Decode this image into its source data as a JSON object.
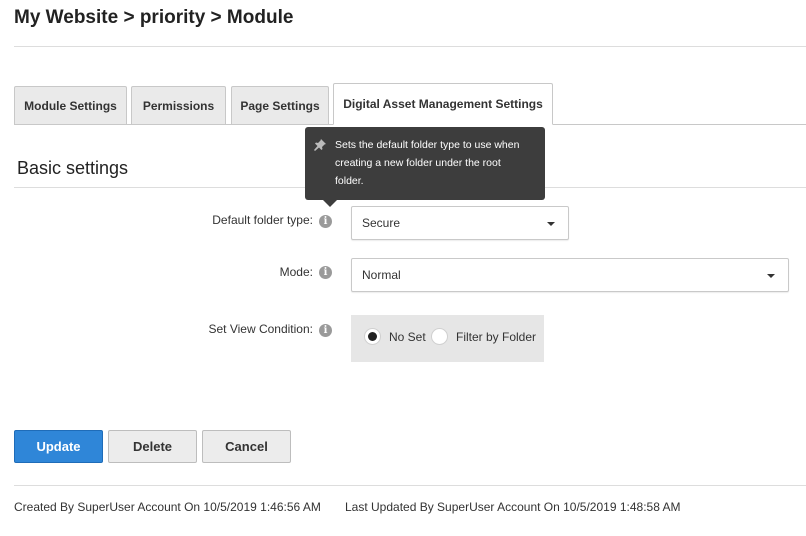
{
  "breadcrumb": "My Website > priority > Module",
  "tabs": [
    {
      "label": "Module Settings"
    },
    {
      "label": "Permissions"
    },
    {
      "label": "Page Settings"
    },
    {
      "label": "Digital Asset Management Settings",
      "active": true
    }
  ],
  "section_title": "Basic settings",
  "tooltip": {
    "line1": "Sets the default folder type to use when",
    "line2": "creating a new folder under the root",
    "line3": "folder.",
    "icon": "pin-icon"
  },
  "fields": {
    "default_folder_type": {
      "label": "Default folder type:",
      "value": "Secure",
      "icon": "info-icon"
    },
    "mode": {
      "label": "Mode:",
      "value": "Normal",
      "icon": "info-icon"
    },
    "view_condition": {
      "label": "Set View Condition:",
      "icon": "info-icon",
      "options": [
        {
          "label": "No Set",
          "selected": true
        },
        {
          "label": "Filter by Folder",
          "selected": false
        }
      ]
    }
  },
  "buttons": {
    "update": "Update",
    "delete": "Delete",
    "cancel": "Cancel"
  },
  "footer": {
    "created": "Created By SuperUser Account On 10/5/2019 1:46:56 AM",
    "updated": "Last Updated By SuperUser Account On 10/5/2019 1:48:58 AM"
  },
  "colors": {
    "primary": "#2f86d8",
    "tooltip_bg": "#3d3d3d",
    "radio_group_bg": "#e6e6e6"
  }
}
